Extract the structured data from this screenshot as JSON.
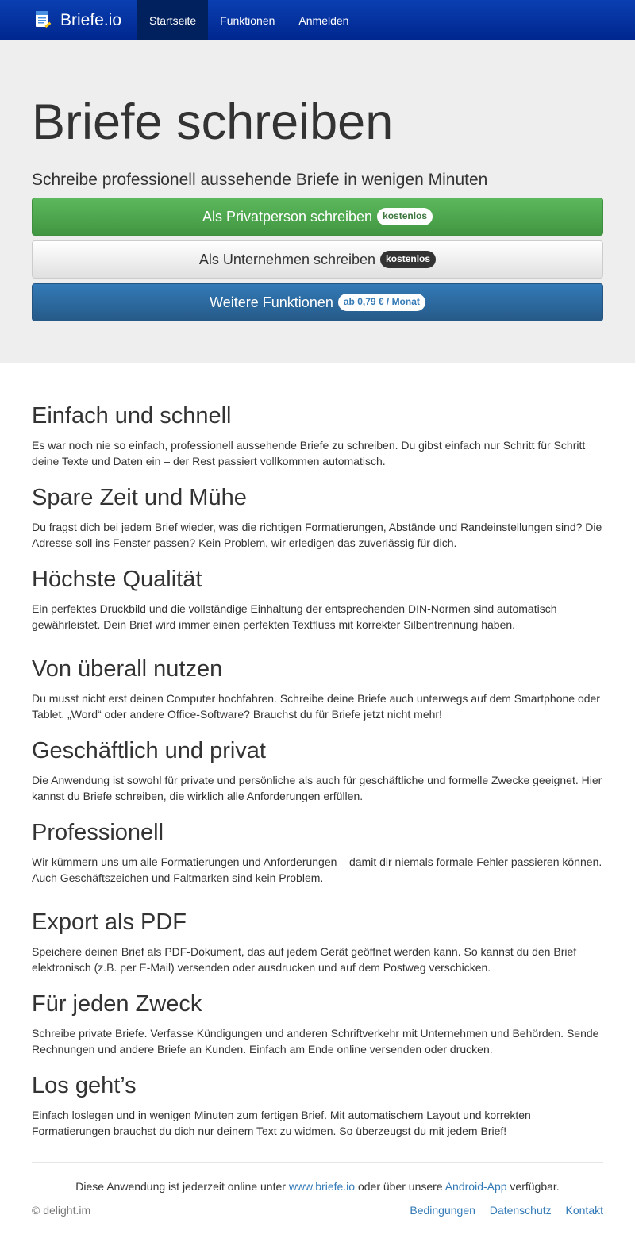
{
  "navbar": {
    "brand": "Briefe.io",
    "items": [
      {
        "label": "Startseite",
        "active": true
      },
      {
        "label": "Funktionen",
        "active": false
      },
      {
        "label": "Anmelden",
        "active": false
      }
    ]
  },
  "hero": {
    "title": "Briefe schreiben",
    "lead": "Schreibe professionell aussehende Briefe in wenigen Minuten",
    "buttons": [
      {
        "label": "Als Privatperson schreiben",
        "badge": "kostenlos"
      },
      {
        "label": "Als Unternehmen schreiben",
        "badge": "kostenlos"
      },
      {
        "label": "Weitere Funktionen",
        "badge": "ab 0,79 € / Monat"
      }
    ]
  },
  "sections": [
    {
      "title": "Einfach und schnell",
      "text": "Es war noch nie so einfach, professionell aussehende Briefe zu schreiben. Du gibst einfach nur Schritt für Schritt deine Texte und Daten ein – der Rest passiert vollkommen automatisch."
    },
    {
      "title": "Spare Zeit und Mühe",
      "text": "Du fragst dich bei jedem Brief wieder, was die richtigen Formatierungen, Abstände und Randeinstellungen sind? Die Adresse soll ins Fenster passen? Kein Problem, wir erledigen das zuverlässig für dich."
    },
    {
      "title": "Höchste Qualität",
      "text": "Ein perfektes Druckbild und die vollständige Einhaltung der entsprechenden DIN-Normen sind automatisch gewährleistet. Dein Brief wird immer einen perfekten Textfluss mit korrekter Silbentrennung haben."
    },
    {
      "title": "Von überall nutzen",
      "text": "Du musst nicht erst deinen Computer hochfahren. Schreibe deine Briefe auch unterwegs auf dem Smartphone oder Tablet. „Word“ oder andere Office-Software? Brauchst du für Briefe jetzt nicht mehr!"
    },
    {
      "title": "Geschäftlich und privat",
      "text": "Die Anwendung ist sowohl für private und persönliche als auch für geschäftliche und formelle Zwecke geeignet. Hier kannst du Briefe schreiben, die wirklich alle Anforderungen erfüllen."
    },
    {
      "title": "Professionell",
      "text": "Wir kümmern uns um alle Formatierungen und Anforderungen – damit dir niemals formale Fehler passieren können. Auch Geschäftszeichen und Faltmarken sind kein Problem."
    },
    {
      "title": "Export als PDF",
      "text": "Speichere deinen Brief als PDF-Dokument, das auf jedem Gerät geöffnet werden kann. So kannst du den Brief elektronisch (z.B. per E-Mail) versenden oder ausdrucken und auf dem Postweg verschicken."
    },
    {
      "title": "Für jeden Zweck",
      "text": "Schreibe private Briefe. Verfasse Kündigungen und anderen Schriftverkehr mit Unternehmen und Behörden. Sende Rechnungen und andere Briefe an Kunden. Einfach am Ende online versenden oder drucken."
    },
    {
      "title": "Los geht’s",
      "text": "Einfach loslegen und in wenigen Minuten zum fertigen Brief. Mit automatischem Layout und korrekten Formatierungen brauchst du dich nur deinem Text zu widmen. So überzeugst du mit jedem Brief!"
    }
  ],
  "footer": {
    "text_before": "Diese Anwendung ist jederzeit online unter ",
    "link1": "www.briefe.io",
    "text_middle": " oder über unsere ",
    "link2": "Android-App",
    "text_after": " verfügbar.",
    "copyright": "© delight.im",
    "links": [
      "Bedingungen",
      "Datenschutz",
      "Kontakt"
    ]
  },
  "colors": {
    "navbar": "#0a3fb1",
    "green": "#5cb85c",
    "blue": "#337ab7",
    "link": "#337ab7"
  }
}
